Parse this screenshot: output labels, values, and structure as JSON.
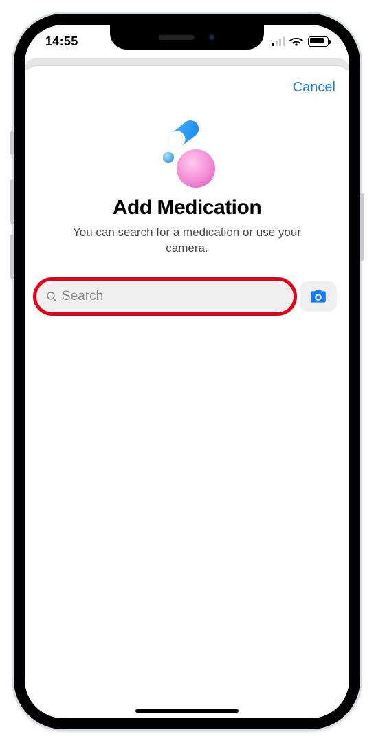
{
  "status_bar": {
    "time": "14:55"
  },
  "nav": {
    "cancel_label": "Cancel"
  },
  "header": {
    "title": "Add Medication",
    "subtitle": "You can search for a medication or use your camera."
  },
  "search": {
    "placeholder": "Search",
    "value": ""
  },
  "icons": {
    "search": "search-icon",
    "camera": "camera-icon",
    "wifi": "wifi-icon",
    "battery": "battery-icon",
    "cell": "cell-signal-icon"
  },
  "colors": {
    "accent": "#167aff",
    "highlight_ring": "#e40015",
    "field_bg": "#efeff0"
  }
}
